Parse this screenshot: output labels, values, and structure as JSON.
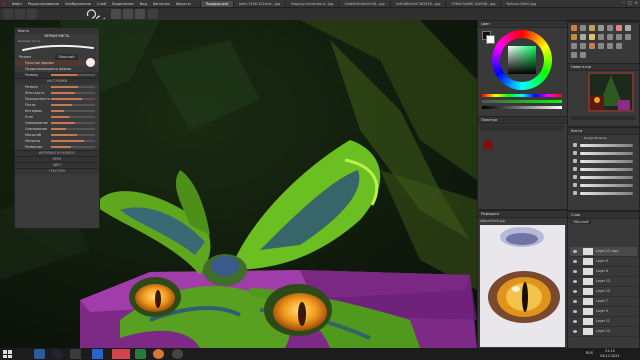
{
  "menubar": {
    "items": [
      "Файл",
      "Редактирование",
      "Изображение",
      "Слой",
      "Выделение",
      "Вид",
      "Фильтры",
      "Фрукты"
    ],
    "tabs": [
      {
        "label": "Подарок.psd",
        "active": true
      },
      {
        "label": "bells-7546-151ckst...jpg",
        "active": false
      },
      {
        "label": "Sloping-christmas-tr...jpg",
        "active": false
      },
      {
        "label": "0hqk0x9n8a4h1ll8...jpg",
        "active": false
      },
      {
        "label": "2e61d8bc5d7162453...jpg",
        "active": false
      },
      {
        "label": "2980e7dd86 12d948...jpg",
        "active": false
      },
      {
        "label": "9p9uuu-D9n0.jpg",
        "active": false
      }
    ]
  },
  "left_docker": {
    "title": "Кисть",
    "preset_name": "ВЕРНАЯ КИСТЬ",
    "preset_sub": "Базовая кисть",
    "mode_label": "Режим",
    "mode_value": "Обычный",
    "options": [
      "Простые формы",
      "Продолжающиеся формы"
    ],
    "size_label": "Размер",
    "sliders": [
      {
        "label": "Размер",
        "value": 0.62
      },
      {
        "label": "Жесткость",
        "value": 0.55
      },
      {
        "label": "Прозрачность",
        "value": 0.7
      },
      {
        "label": "Поток",
        "value": 0.48
      },
      {
        "label": "Интервал",
        "value": 0.3
      },
      {
        "label": "Угол",
        "value": 0.4
      },
      {
        "label": "Смешивание",
        "value": 0.55
      },
      {
        "label": "Смазывание",
        "value": 0.33
      }
    ],
    "section_sliders": [
      {
        "label": "Масштаб",
        "value": 0.6
      },
      {
        "label": "Непрозр.",
        "value": 0.75
      },
      {
        "label": "Размытие",
        "value": 0.45
      }
    ],
    "section_labels": [
      "НАСТРОЙКИ",
      "ИНТЕРВАЛ И РАЗБРОС",
      "ЯРКО",
      "ЦВЕТ",
      "ТЕКСТУРА"
    ]
  },
  "right": {
    "color_title": "Цвет",
    "navigator_title": "Навигатор",
    "palette_title": "Палитра",
    "brushes_title": "Кисти",
    "brush_set": "Rough Brushes",
    "reference_title": "Референс",
    "reference_file": "d8pzoh0m9.jpg",
    "layers_title": "Слои",
    "layers_mode": "Обычный",
    "layers": [
      "Layer 11 copy",
      "Layer 6",
      "Layer 8",
      "Layer 13",
      "Layer 10",
      "Layer 7",
      "Layer 9",
      "Layer 11",
      "Layer 14"
    ]
  },
  "taskbar": {
    "clock": "21:12",
    "date": "06.12.2021",
    "lang": "RUS"
  },
  "colors": {
    "accent": "#c87850",
    "panel": "#393939",
    "bg": "#2b2b2b"
  }
}
